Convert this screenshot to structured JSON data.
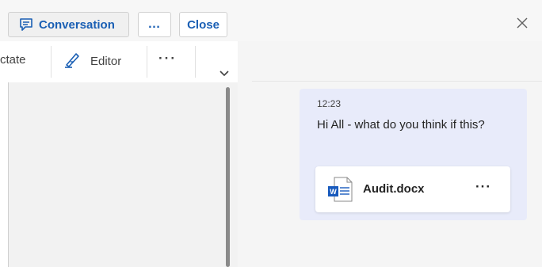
{
  "header": {
    "conversation_label": "Conversation",
    "more_label": "…",
    "close_label": "Close",
    "pane_close_icon": "close-icon"
  },
  "ribbon": {
    "dictate_label": "ctate",
    "editor_label": "Editor",
    "more_label": "···",
    "expand_icon": "chevron-down-icon"
  },
  "chat": {
    "message": {
      "time": "12:23",
      "text": "Hi All - what do you think if this?",
      "attachment": {
        "file_name": "Audit.docx",
        "file_icon": "word-document-icon",
        "more_label": "···"
      }
    }
  },
  "colors": {
    "accent": "#1a5fb4",
    "bubble": "#e8ebfa",
    "word_blue": "#185abd",
    "pane_bg": "#f5f5f5"
  }
}
